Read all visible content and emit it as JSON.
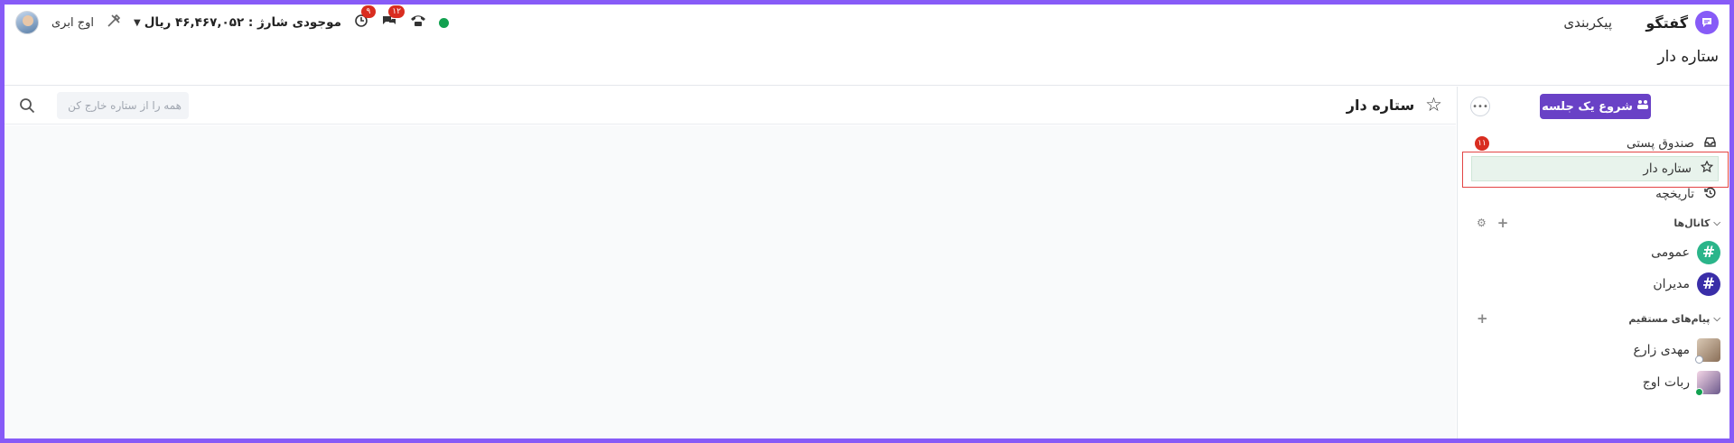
{
  "header": {
    "app_title": "گفتگو",
    "settings_label": "پیکربندی",
    "balance": "موجودی شارژ : ۴۶,۴۶۷,۰۵۲ ریال",
    "user_name": "اوج ابری",
    "notifications": {
      "history_badge": "۹",
      "messages_badge": "۱۲"
    },
    "online_status_color": "#12a150"
  },
  "page": {
    "title": "ستاره دار"
  },
  "sidebar": {
    "start_button": "شروع یک جلسه",
    "nav": [
      {
        "label": "صندوق پستی",
        "icon": "inbox-icon",
        "badge": "۱۱"
      },
      {
        "label": "ستاره دار",
        "icon": "star-icon",
        "active": true
      },
      {
        "label": "تاریخچه",
        "icon": "history-icon"
      }
    ],
    "channels_header": "کانال‌ها",
    "channels": [
      {
        "name": "عمومی",
        "color": "#2bb58a"
      },
      {
        "name": "مدیران",
        "color": "#3a2ea8"
      }
    ],
    "dms_header": "پیام‌های مستقیم",
    "dms": [
      {
        "name": "مهدی زارع",
        "presence": "offline"
      },
      {
        "name": "ربات اوج",
        "presence": "online"
      }
    ]
  },
  "main": {
    "title": "ستاره دار",
    "search_placeholder": "همه را از ستاره خارج کن"
  },
  "colors": {
    "accent": "#875bf7",
    "button": "#6941c6",
    "badge": "#d92d20"
  }
}
